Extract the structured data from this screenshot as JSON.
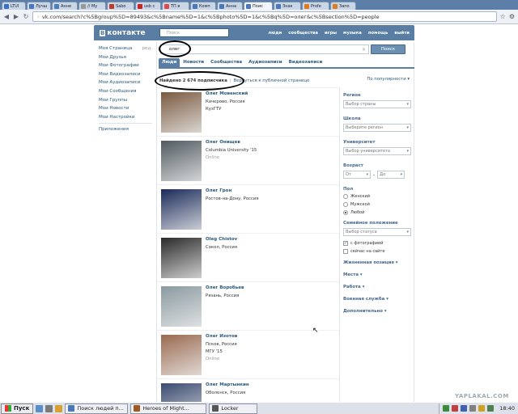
{
  "browser": {
    "tabs": [
      {
        "label": "LTUI",
        "color": "#3b6fc4"
      },
      {
        "label": "Лучш",
        "color": "#4b78b8"
      },
      {
        "label": "Анне",
        "color": "#4a7fba"
      },
      {
        "label": "// Му",
        "color": "#999999"
      },
      {
        "label": "Sabo",
        "color": "#c0392b"
      },
      {
        "label": "usb с",
        "color": "#cc2222"
      },
      {
        "label": "ТП в",
        "color": "#e24a4a"
      },
      {
        "label": "Комп",
        "color": "#4b78b8"
      },
      {
        "label": "Анна",
        "color": "#4b78b8"
      },
      {
        "label": "Поис",
        "color": "#4b78b8",
        "active": true
      },
      {
        "label": "Знак",
        "color": "#4b78b8"
      },
      {
        "label": "Profe",
        "color": "#e07a20"
      },
      {
        "label": "Запо",
        "color": "#e07a20"
      }
    ],
    "url": "vk.com/search?c%5Bgroup%5D=89493&c%5Bname%5D=1&c%5Bphoto%5D=1&c%5Bq%5D=олег&c%5Bsection%5D=people"
  },
  "vk": {
    "logo": "контакте",
    "logo_b": "В",
    "top_search_placeholder": "Поиск",
    "topnav": [
      "люди",
      "сообщества",
      "игры",
      "музыка",
      "помощь",
      "выйти"
    ]
  },
  "leftmenu": {
    "first": "Моя Страница",
    "edit": "ред.",
    "items": [
      "Мои Друзья",
      "Мои Фотографии",
      "Мои Видеозаписи",
      "Мои Аудиозаписи",
      "Мои Сообщения",
      "Мои Группы",
      "Мои Новости",
      "Мои Настройки"
    ],
    "apps": "Приложения"
  },
  "search": {
    "query": "олег",
    "button": "Поиск",
    "tabs": [
      "Люди",
      "Новости",
      "Сообщества",
      "Аудиозаписи",
      "Видеозаписи"
    ],
    "summary_prefix": "Найдено 2 674 подписчика",
    "summary_sep": "|",
    "summary_link": "Вернуться к публичной странице",
    "sort": "По популярности"
  },
  "results": [
    {
      "name": "Олег Мовенский",
      "line1": "Качерово, Россия",
      "line2": "КузГТУ",
      "online": false,
      "photo": "#7a5a40"
    },
    {
      "name": "Олег Онищев",
      "line1": "Columbia University '15",
      "line2": "Online",
      "online": true,
      "photo": "#505a60"
    },
    {
      "name": "Олег Грон",
      "line1": "Ростов-на-Дону, Россия",
      "line2": "",
      "online": false,
      "photo": "#1a2a5a"
    },
    {
      "name": "Oleg Chistov",
      "line1": "Сокол, Россия",
      "line2": "",
      "online": false,
      "photo": "#2a2a2a"
    },
    {
      "name": "Олег Воробьев",
      "line1": "Рязань, Россия",
      "line2": "",
      "online": false,
      "photo": "#8a9aa0"
    },
    {
      "name": "Олег Изотов",
      "line1": "Псков, Россия",
      "line2": "МГУ '15",
      "line3": "Online",
      "online": true,
      "photo": "#9a6a50"
    },
    {
      "name": "Олег Мартынкин",
      "line1": "Оболенск, Россия",
      "line2": "",
      "online": false,
      "photo": "#3a4a70"
    }
  ],
  "filters": {
    "region": {
      "title": "Регион",
      "value": "Выбор страны"
    },
    "school": {
      "title": "Школа",
      "value": "Выберите регион"
    },
    "university": {
      "title": "Университет",
      "value": "Выбор университета"
    },
    "age": {
      "title": "Возраст",
      "from": "От",
      "dash": "-",
      "to": "До"
    },
    "sex": {
      "title": "Пол",
      "options": [
        "Женский",
        "Мужской",
        "Любой"
      ],
      "selected": 2
    },
    "status": {
      "title": "Семейное положение",
      "value": "Выбор статуса"
    },
    "with_photo": "с фотографией",
    "online_now": "сейчас на сайте",
    "expandable": [
      "Жизненная позиция",
      "Места",
      "Работа",
      "Военная служба",
      "Дополнительно"
    ]
  },
  "taskbar": {
    "start": "Пуск",
    "windows": [
      {
        "label": "Поиск людей п...",
        "color": "#4b78b8"
      },
      {
        "label": "Heroes of Might...",
        "color": "#a05a20"
      },
      {
        "label": "Locker",
        "color": "#555555"
      }
    ],
    "clock": "18:40"
  },
  "watermark": "YAPLAKAL.COM"
}
